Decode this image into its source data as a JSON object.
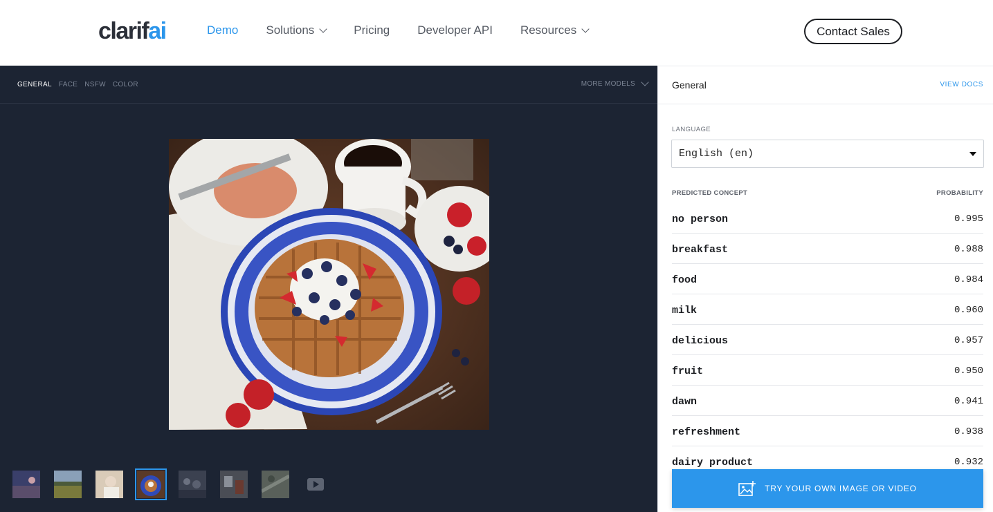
{
  "nav": {
    "logo_main": "clarif",
    "logo_accent": "ai",
    "links": [
      {
        "label": "Demo",
        "dropdown": false,
        "active": true
      },
      {
        "label": "Solutions",
        "dropdown": true,
        "active": false
      },
      {
        "label": "Pricing",
        "dropdown": false,
        "active": false
      },
      {
        "label": "Developer API",
        "dropdown": false,
        "active": false
      },
      {
        "label": "Resources",
        "dropdown": true,
        "active": false
      }
    ],
    "contact_label": "Contact Sales"
  },
  "models": {
    "tabs": [
      "GENERAL",
      "FACE",
      "NSFW",
      "COLOR"
    ],
    "active_tab": "GENERAL",
    "more_label": "MORE MODELS"
  },
  "panel": {
    "title": "General",
    "docs_label": "VIEW DOCS",
    "language_label": "LANGUAGE",
    "language_value": "English (en)",
    "concept_header": "PREDICTED CONCEPT",
    "probability_header": "PROBABILITY",
    "concepts": [
      {
        "name": "no person",
        "prob": "0.995"
      },
      {
        "name": "breakfast",
        "prob": "0.988"
      },
      {
        "name": "food",
        "prob": "0.984"
      },
      {
        "name": "milk",
        "prob": "0.960"
      },
      {
        "name": "delicious",
        "prob": "0.957"
      },
      {
        "name": "fruit",
        "prob": "0.950"
      },
      {
        "name": "dawn",
        "prob": "0.941"
      },
      {
        "name": "refreshment",
        "prob": "0.938"
      },
      {
        "name": "dairy product",
        "prob": "0.932"
      }
    ],
    "try_label": "TRY YOUR OWN IMAGE OR VIDEO"
  },
  "thumbnails": {
    "count": 7,
    "selected_index": 3,
    "has_video": true
  },
  "colors": {
    "accent": "#2c96eb",
    "dark_bg": "#1c2433"
  }
}
